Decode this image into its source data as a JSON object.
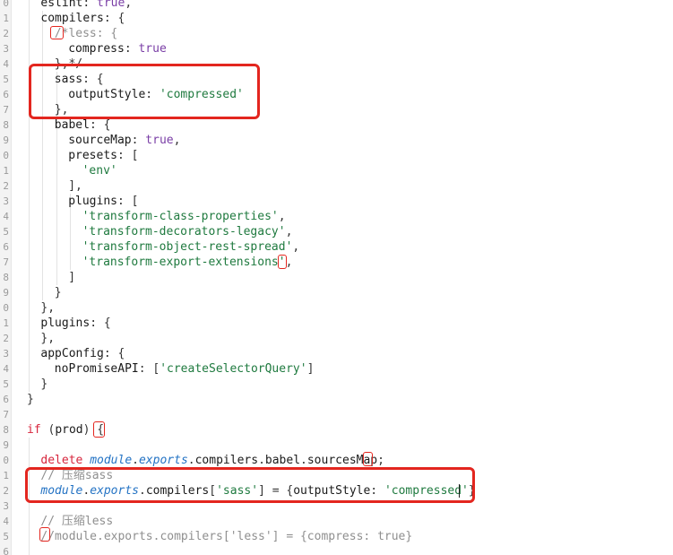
{
  "editor": {
    "line_numbers": [
      "0",
      "1",
      "2",
      "3",
      "4",
      "5",
      "6",
      "7",
      "8",
      "9",
      "0",
      "1",
      "2",
      "3",
      "4",
      "5",
      "6",
      "7",
      "8",
      "9",
      "0",
      "1",
      "2",
      "3",
      "4",
      "5",
      "6",
      "7",
      "8",
      "9",
      "0",
      "1",
      "2",
      "3",
      "4",
      "5",
      "6"
    ],
    "lines": [
      {
        "indent": 1,
        "text": "eslint: true,"
      },
      {
        "indent": 1,
        "text": "compilers: {"
      },
      {
        "indent": 2,
        "text": "/*less: {"
      },
      {
        "indent": 3,
        "text": "compress: true"
      },
      {
        "indent": 2,
        "text": "},*/"
      },
      {
        "indent": 2,
        "text": "sass: {"
      },
      {
        "indent": 3,
        "text": "outputStyle: 'compressed'"
      },
      {
        "indent": 2,
        "text": "},"
      },
      {
        "indent": 2,
        "text": "babel: {"
      },
      {
        "indent": 3,
        "text": "sourceMap: true,"
      },
      {
        "indent": 3,
        "text": "presets: ["
      },
      {
        "indent": 4,
        "text": "'env'"
      },
      {
        "indent": 3,
        "text": "],"
      },
      {
        "indent": 3,
        "text": "plugins: ["
      },
      {
        "indent": 4,
        "text": "'transform-class-properties',"
      },
      {
        "indent": 4,
        "text": "'transform-decorators-legacy',"
      },
      {
        "indent": 4,
        "text": "'transform-object-rest-spread',"
      },
      {
        "indent": 4,
        "text": "'transform-export-extensions',"
      },
      {
        "indent": 3,
        "text": "]"
      },
      {
        "indent": 2,
        "text": "}"
      },
      {
        "indent": 1,
        "text": "},"
      },
      {
        "indent": 1,
        "text": "plugins: {"
      },
      {
        "indent": 1,
        "text": "},"
      },
      {
        "indent": 1,
        "text": "appConfig: {"
      },
      {
        "indent": 2,
        "text": "noPromiseAPI: ['createSelectorQuery']"
      },
      {
        "indent": 1,
        "text": "}"
      },
      {
        "indent": 0,
        "text": "}"
      },
      {
        "indent": 0,
        "text": ""
      },
      {
        "indent": 0,
        "text": "if (prod) {"
      },
      {
        "indent": 0,
        "text": ""
      },
      {
        "indent": 1,
        "text": "delete module.exports.compilers.babel.sourcesMap;"
      },
      {
        "indent": 1,
        "text": "// 压缩sass"
      },
      {
        "indent": 1,
        "text": "module.exports.compilers['sass'] = {outputStyle: 'compressed'}"
      },
      {
        "indent": 0,
        "text": ""
      },
      {
        "indent": 1,
        "text": "// 压缩less"
      },
      {
        "indent": 1,
        "text": "//module.exports.compilers['less'] = {compress: true}"
      },
      {
        "indent": 0,
        "text": ""
      }
    ],
    "colors": {
      "highlight_box": "#e3261f",
      "string": "#1f7a3f",
      "keyword": "#d7263d",
      "boolean": "#7a3ea6",
      "italic_ident": "#2473c4",
      "comment": "#8f8f8f"
    }
  }
}
